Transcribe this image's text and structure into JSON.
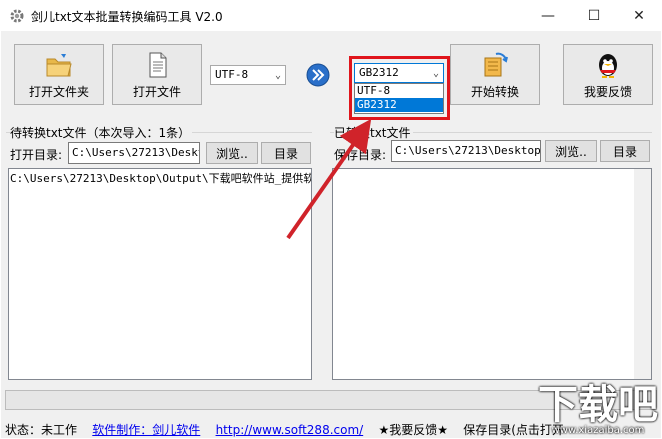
{
  "window": {
    "title": "剑儿txt文本批量转换编码工具 V2.0",
    "minimize": "—",
    "maximize": "☐",
    "close": "✕"
  },
  "toolbar": {
    "open_folder": "打开文件夹",
    "open_file": "打开文件",
    "source_encoding": "UTF-8",
    "target_encoding": "GB2312",
    "start_convert": "开始转换",
    "feedback": "我要反馈"
  },
  "encoding_dropdown": {
    "options": [
      "UTF-8",
      "GB2312"
    ],
    "selected": "GB2312"
  },
  "left_panel": {
    "group_label": "待转换txt文件（本次导入：1条）",
    "dir_label": "打开目录:",
    "dir_value": "C:\\Users\\27213\\Deskto",
    "browse": "浏览..",
    "dir_button": "目录",
    "files": [
      "C:\\Users\\27213\\Desktop\\Output\\下载吧软件站_提供软"
    ]
  },
  "right_panel": {
    "group_label": "已转换txt文件",
    "dir_label": "保存目录:",
    "dir_value": "C:\\Users\\27213\\Desktop",
    "browse": "浏览..",
    "dir_button": "目录"
  },
  "progress": {
    "value": 0
  },
  "status": {
    "state": "状态：未工作",
    "author_link": "软件制作：剑儿软件",
    "url_link": "http://www.soft288.com/",
    "feedback": "★我要反馈★",
    "save_dir_hint": "保存目录(点击打开"
  },
  "watermark": {
    "big": "下载吧",
    "small": "www.xiazaiba.com"
  },
  "colors": {
    "highlight_box": "#e0151c",
    "annotation_arrow": "#d0232a",
    "selection": "#0078d7"
  }
}
